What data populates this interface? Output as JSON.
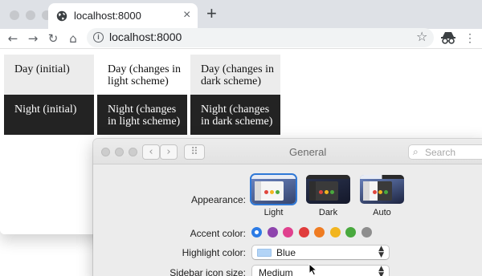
{
  "browser": {
    "tab_title": "localhost:8000",
    "tab_close": "×",
    "new_tab": "+",
    "back": "←",
    "forward": "→",
    "reload": "↻",
    "home": "⌂",
    "url": "localhost:8000",
    "star": "☆",
    "menu": "⋮"
  },
  "page": {
    "cells": [
      {
        "text": "Day (initial)"
      },
      {
        "text": "Day (changes in light scheme)"
      },
      {
        "text": "Day (changes in dark scheme)"
      },
      {
        "text": "Night (initial)"
      },
      {
        "text": "Night (changes in light scheme)"
      },
      {
        "text": "Night (changes in dark scheme)"
      }
    ]
  },
  "prefs": {
    "title": "General",
    "back_btn": "‹",
    "fwd_btn": "›",
    "grid_btn": "⠿",
    "search_placeholder": "Search",
    "appearance_label": "Appearance:",
    "appearance_options": [
      "Light",
      "Dark",
      "Auto"
    ],
    "appearance_selected": "Light",
    "accent_label": "Accent color:",
    "accent_colors": [
      "#2c7be5",
      "#8e44ad",
      "#e0418e",
      "#e03c3c",
      "#ef7c22",
      "#f2b51f",
      "#49a93e",
      "#8e8e8e"
    ],
    "accent_selected": "#2c7be5",
    "highlight_label": "Highlight color:",
    "highlight_value": "Blue",
    "sidebar_label": "Sidebar icon size:",
    "sidebar_value": "Medium"
  }
}
